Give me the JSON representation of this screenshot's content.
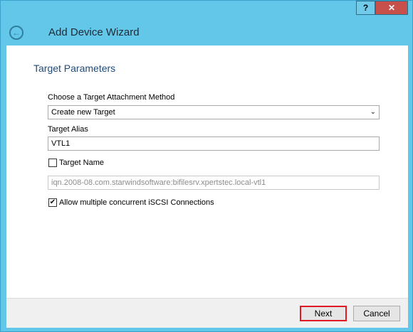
{
  "window": {
    "help_label": "?",
    "close_label": "✕",
    "back_icon": "back-arrow-icon",
    "title": "Add Device Wizard"
  },
  "section": {
    "title": "Target Parameters"
  },
  "form": {
    "attachment_method_label": "Choose a Target Attachment Method",
    "attachment_method_value": "Create new Target",
    "alias_label": "Target Alias",
    "alias_value": "VTL1",
    "target_name_label": "Target Name",
    "target_name_checked": false,
    "target_name_value": "iqn.2008-08.com.starwindsoftware:bifilesrv.xpertstec.local-vtl1",
    "multiple_connections_label": "Allow multiple concurrent iSCSI Connections",
    "multiple_connections_checked": true
  },
  "footer": {
    "next_label": "Next",
    "cancel_label": "Cancel"
  },
  "colors": {
    "titlebar": "#63c7ea",
    "close": "#c7504b",
    "next_highlight": "#e01a22",
    "section_title": "#1f4a7a"
  }
}
